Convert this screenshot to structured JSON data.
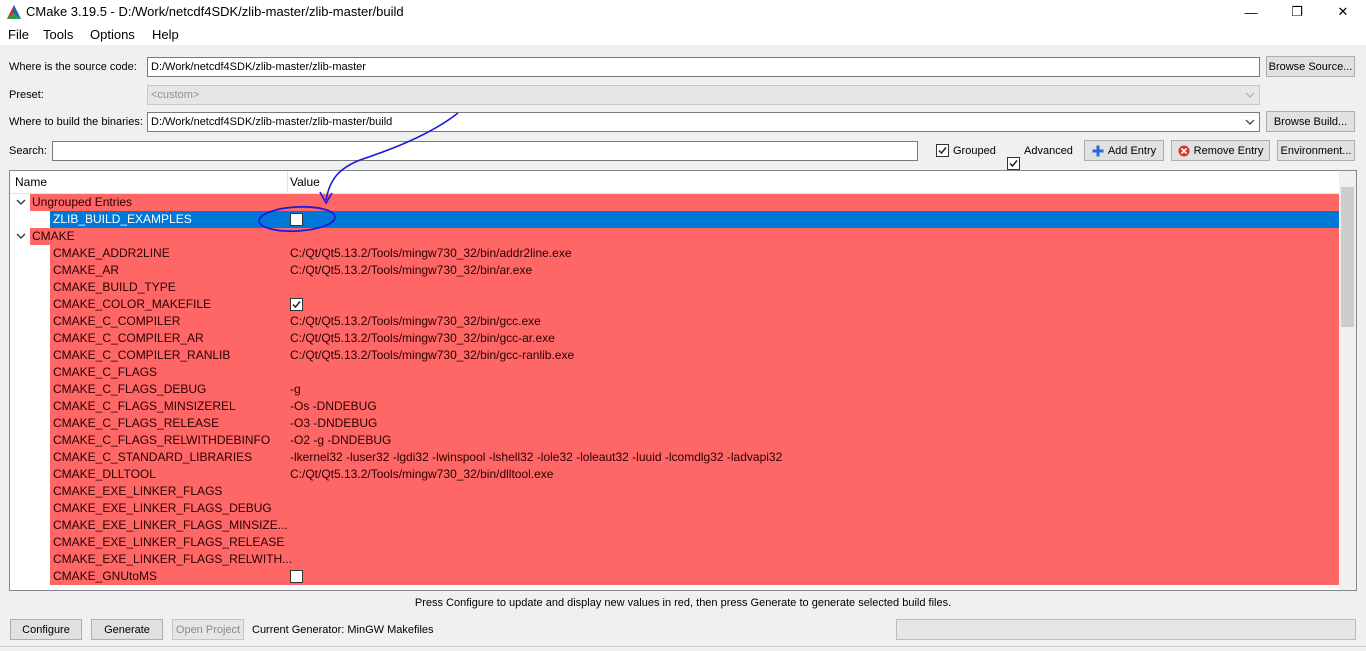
{
  "window": {
    "title": "CMake 3.19.5 - D:/Work/netcdf4SDK/zlib-master/zlib-master/build",
    "minimize": "—",
    "restore": "❐",
    "close": "✕"
  },
  "menu": [
    "File",
    "Tools",
    "Options",
    "Help"
  ],
  "source": {
    "label": "Where is the source code:",
    "value": "D:/Work/netcdf4SDK/zlib-master/zlib-master",
    "browse_label": "Browse Source..."
  },
  "preset": {
    "label": "Preset:",
    "value": "<custom>"
  },
  "build": {
    "label": "Where to build the binaries:",
    "value": "D:/Work/netcdf4SDK/zlib-master/zlib-master/build",
    "browse_label": "Browse Build..."
  },
  "search": {
    "label": "Search:",
    "value": ""
  },
  "options": {
    "grouped_label": "Grouped",
    "grouped": true,
    "advanced_label": "Advanced",
    "advanced": true,
    "add_entry_label": "Add Entry",
    "remove_entry_label": "Remove Entry",
    "environment_label": "Environment..."
  },
  "table": {
    "col_name": "Name",
    "col_value": "Value",
    "groups": [
      {
        "label": "Ungrouped Entries",
        "entries": [
          {
            "name": "ZLIB_BUILD_EXAMPLES",
            "type": "bool",
            "checked": false,
            "selected": true
          }
        ]
      },
      {
        "label": "CMAKE",
        "entries": [
          {
            "name": "CMAKE_ADDR2LINE",
            "value": "C:/Qt/Qt5.13.2/Tools/mingw730_32/bin/addr2line.exe"
          },
          {
            "name": "CMAKE_AR",
            "value": "C:/Qt/Qt5.13.2/Tools/mingw730_32/bin/ar.exe"
          },
          {
            "name": "CMAKE_BUILD_TYPE",
            "value": ""
          },
          {
            "name": "CMAKE_COLOR_MAKEFILE",
            "type": "bool",
            "checked": true
          },
          {
            "name": "CMAKE_C_COMPILER",
            "value": "C:/Qt/Qt5.13.2/Tools/mingw730_32/bin/gcc.exe"
          },
          {
            "name": "CMAKE_C_COMPILER_AR",
            "value": "C:/Qt/Qt5.13.2/Tools/mingw730_32/bin/gcc-ar.exe"
          },
          {
            "name": "CMAKE_C_COMPILER_RANLIB",
            "value": "C:/Qt/Qt5.13.2/Tools/mingw730_32/bin/gcc-ranlib.exe"
          },
          {
            "name": "CMAKE_C_FLAGS",
            "value": ""
          },
          {
            "name": "CMAKE_C_FLAGS_DEBUG",
            "value": "-g"
          },
          {
            "name": "CMAKE_C_FLAGS_MINSIZEREL",
            "value": "-Os -DNDEBUG"
          },
          {
            "name": "CMAKE_C_FLAGS_RELEASE",
            "value": "-O3 -DNDEBUG"
          },
          {
            "name": "CMAKE_C_FLAGS_RELWITHDEBINFO",
            "value": "-O2 -g -DNDEBUG"
          },
          {
            "name": "CMAKE_C_STANDARD_LIBRARIES",
            "value": "-lkernel32 -luser32 -lgdi32 -lwinspool -lshell32 -lole32 -loleaut32 -luuid -lcomdlg32 -ladvapi32"
          },
          {
            "name": "CMAKE_DLLTOOL",
            "value": "C:/Qt/Qt5.13.2/Tools/mingw730_32/bin/dlltool.exe"
          },
          {
            "name": "CMAKE_EXE_LINKER_FLAGS",
            "value": ""
          },
          {
            "name": "CMAKE_EXE_LINKER_FLAGS_DEBUG",
            "value": ""
          },
          {
            "name": "CMAKE_EXE_LINKER_FLAGS_MINSIZE...",
            "value": ""
          },
          {
            "name": "CMAKE_EXE_LINKER_FLAGS_RELEASE",
            "value": ""
          },
          {
            "name": "CMAKE_EXE_LINKER_FLAGS_RELWITH...",
            "value": ""
          },
          {
            "name": "CMAKE_GNUtoMS",
            "type": "bool",
            "checked": false
          }
        ]
      }
    ]
  },
  "status_message": "Press Configure to update and display new values in red, then press Generate to generate selected build files.",
  "bottom": {
    "configure_label": "Configure",
    "generate_label": "Generate",
    "open_project_label": "Open Project",
    "generator_text": "Current Generator: MinGW Makefiles"
  },
  "colors": {
    "changed_row": "#ff6666",
    "selected_row": "#0078d7",
    "annotation_ink": "#1a1adc"
  }
}
